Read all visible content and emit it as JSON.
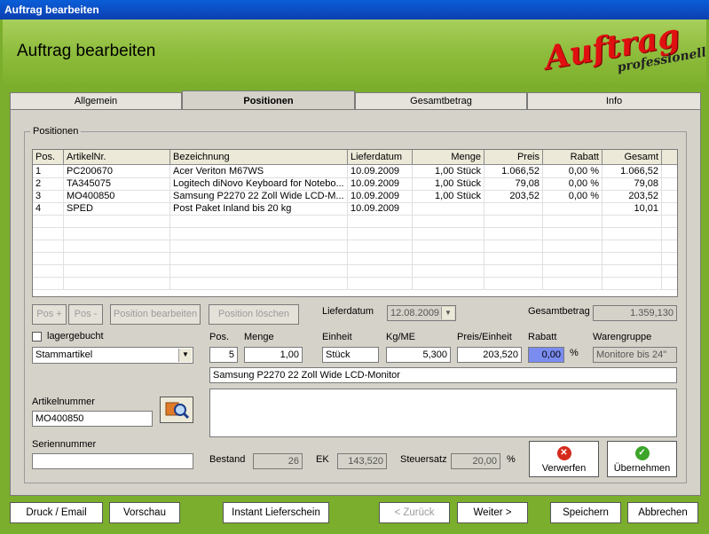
{
  "window": {
    "title": "Auftrag bearbeiten"
  },
  "header": {
    "title": "Auftrag bearbeiten",
    "logo_main": "Auftrag",
    "logo_sub": "professionell"
  },
  "tabs": [
    {
      "label": "Allgemein"
    },
    {
      "label": "Positionen"
    },
    {
      "label": "Gesamtbetrag"
    },
    {
      "label": "Info"
    }
  ],
  "group_label": "Positionen",
  "grid": {
    "columns": [
      "Pos.",
      "ArtikelNr.",
      "Bezeichnung",
      "Lieferdatum",
      "Menge",
      "Preis",
      "Rabatt",
      "Gesamt"
    ],
    "rows": [
      [
        "1",
        "PC200670",
        "Acer Veriton M67WS",
        "10.09.2009",
        "1,00 Stück",
        "1.066,52",
        "0,00 %",
        "1.066,52"
      ],
      [
        "2",
        "TA345075",
        "Logitech diNovo Keyboard for Notebo...",
        "10.09.2009",
        "1,00 Stück",
        "79,08",
        "0,00 %",
        "79,08"
      ],
      [
        "3",
        "MO400850",
        "Samsung P2270 22 Zoll Wide LCD-M...",
        "10.09.2009",
        "1,00 Stück",
        "203,52",
        "0,00 %",
        "203,52"
      ],
      [
        "4",
        "SPED",
        "Post Paket Inland bis 20 kg",
        "10.09.2009",
        "",
        "",
        "",
        "10,01"
      ]
    ]
  },
  "buttons": {
    "pos_plus": "Pos +",
    "pos_minus": "Pos -",
    "pos_edit": "Position bearbeiten",
    "pos_delete": "Position löschen",
    "discard": "Verwerfen",
    "accept": "Übernehmen"
  },
  "form": {
    "lieferdatum_label": "Lieferdatum",
    "lieferdatum_value": "12.08.2009",
    "gesamtbetrag_label": "Gesamtbetrag",
    "gesamtbetrag_value": "1.359,130",
    "lagergebucht_label": "lagergebucht",
    "artikeltyp_value": "Stammartikel",
    "pos_label": "Pos.",
    "pos_value": "5",
    "menge_label": "Menge",
    "menge_value": "1,00",
    "einheit_label": "Einheit",
    "einheit_value": "Stück",
    "kgme_label": "Kg/ME",
    "kgme_value": "5,300",
    "preis_label": "Preis/Einheit",
    "preis_value": "203,520",
    "rabatt_label": "Rabatt",
    "rabatt_value": "0,00",
    "rabatt_unit": "%",
    "warengruppe_label": "Warengruppe",
    "warengruppe_value": "Monitore bis 24\"",
    "bezeichnung_value": "Samsung P2270 22 Zoll Wide LCD-Monitor",
    "beschreibung_value": "",
    "artikelnummer_label": "Artikelnummer",
    "artikelnummer_value": "MO400850",
    "seriennummer_label": "Seriennummer",
    "seriennummer_value": "",
    "bestand_label": "Bestand",
    "bestand_value": "26",
    "ek_label": "EK",
    "ek_value": "143,520",
    "steuersatz_label": "Steuersatz",
    "steuersatz_value": "20,00",
    "steuersatz_unit": "%"
  },
  "footer": {
    "druck": "Druck / Email",
    "vorschau": "Vorschau",
    "lieferschein": "Instant Lieferschein",
    "zurueck": "< Zurück",
    "weiter": "Weiter >",
    "speichern": "Speichern",
    "abbrechen": "Abbrechen"
  },
  "colors": {
    "frame_green": "#7aae2c",
    "panel": "#d5d2c9",
    "titlebar": "#0a5ed8",
    "logo_red": "#e01010"
  },
  "icons": {
    "discard": "x-circle-red-icon",
    "accept": "check-circle-green-icon",
    "search": "magnifier-icon"
  }
}
